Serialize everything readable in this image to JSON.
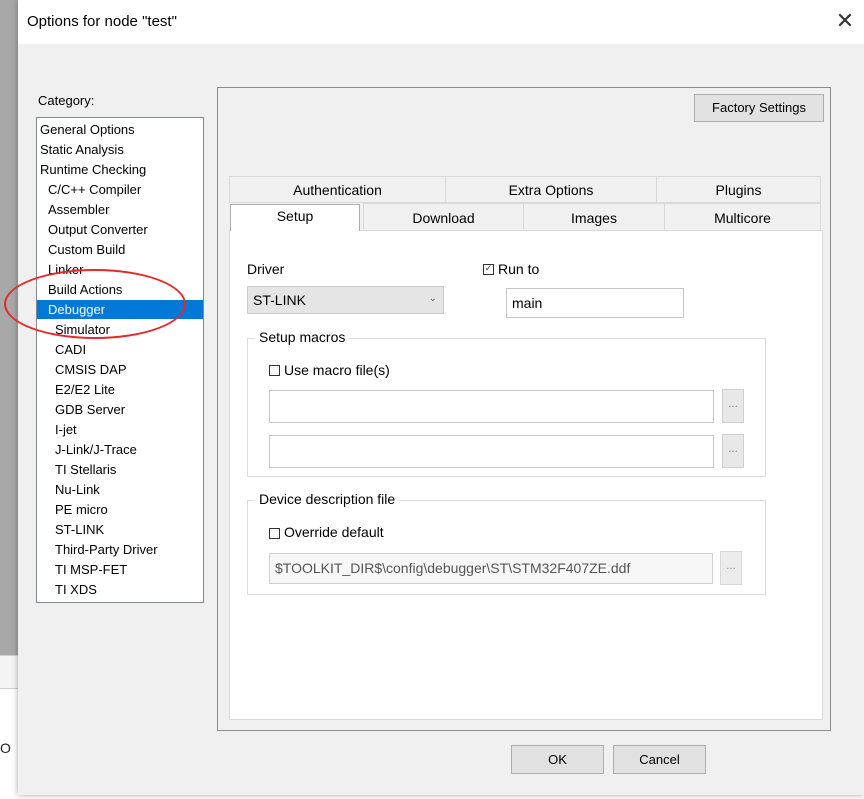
{
  "background": {
    "fragment": "O"
  },
  "dialog": {
    "title": "Options for node \"test\"",
    "close_glyph": "✕",
    "category_label": "Category:",
    "factory_settings": "Factory Settings",
    "ok": "OK",
    "cancel": "Cancel"
  },
  "categories": [
    {
      "label": "General Options",
      "indent": 0
    },
    {
      "label": "Static Analysis",
      "indent": 0
    },
    {
      "label": "Runtime Checking",
      "indent": 0
    },
    {
      "label": "C/C++ Compiler",
      "indent": 1
    },
    {
      "label": "Assembler",
      "indent": 1
    },
    {
      "label": "Output Converter",
      "indent": 1
    },
    {
      "label": "Custom Build",
      "indent": 1
    },
    {
      "label": "Linker",
      "indent": 1
    },
    {
      "label": "Build Actions",
      "indent": 1
    },
    {
      "label": "Debugger",
      "indent": 1,
      "selected": true
    },
    {
      "label": "Simulator",
      "indent": 2
    },
    {
      "label": "CADI",
      "indent": 2
    },
    {
      "label": "CMSIS DAP",
      "indent": 2
    },
    {
      "label": "E2/E2 Lite",
      "indent": 2
    },
    {
      "label": "GDB Server",
      "indent": 2
    },
    {
      "label": "I-jet",
      "indent": 2
    },
    {
      "label": "J-Link/J-Trace",
      "indent": 2
    },
    {
      "label": "TI Stellaris",
      "indent": 2
    },
    {
      "label": "Nu-Link",
      "indent": 2
    },
    {
      "label": "PE micro",
      "indent": 2
    },
    {
      "label": "ST-LINK",
      "indent": 2
    },
    {
      "label": "Third-Party Driver",
      "indent": 2
    },
    {
      "label": "TI MSP-FET",
      "indent": 2
    },
    {
      "label": "TI XDS",
      "indent": 2
    }
  ],
  "tabs": {
    "row1": [
      "Authentication",
      "Extra Options",
      "Plugins"
    ],
    "row2": [
      "Setup",
      "Download",
      "Images",
      "Multicore"
    ],
    "active": "Setup"
  },
  "setup": {
    "driver_label": "Driver",
    "driver_value": "ST-LINK",
    "run_to_label": "Run to",
    "run_to_checked": true,
    "run_to_value": "main",
    "macros_title": "Setup macros",
    "use_macro_label": "Use macro file(s)",
    "use_macro_checked": false,
    "macro_file_1": "",
    "macro_file_2": "",
    "browse_label": "...",
    "device_title": "Device description file",
    "override_label": "Override default",
    "override_checked": false,
    "device_path": "$TOOLKIT_DIR$\\config\\debugger\\ST\\STM32F407ZE.ddf"
  },
  "colors": {
    "selection": "#0078d7",
    "annotation": "#e32b2b"
  }
}
